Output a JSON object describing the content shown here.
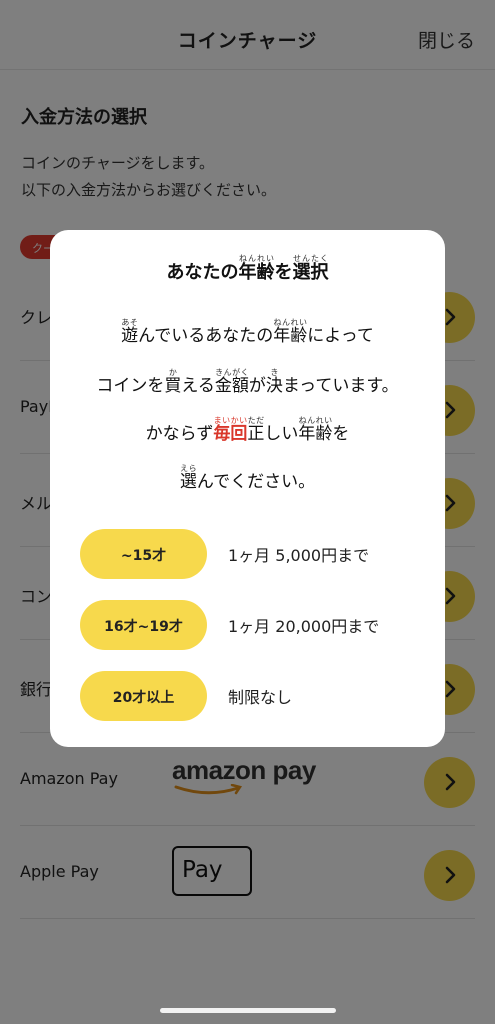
{
  "header": {
    "title": "コインチャージ",
    "close_label": "閉じる"
  },
  "section_title": "入金方法の選択",
  "description": {
    "line1": "コインのチャージをします。",
    "line2": "以下の入金方法からお選びください。"
  },
  "coupon_badge": "クーポン",
  "payment_methods": [
    {
      "label": "クレジットカード"
    },
    {
      "label": "PayPay"
    },
    {
      "label": "メルペイ"
    },
    {
      "label": "コンビニ"
    },
    {
      "label": "銀行振込"
    },
    {
      "label": "Amazon Pay",
      "logo_text": "amazon pay"
    },
    {
      "label": "Apple Pay",
      "logo_text": "Pay"
    }
  ],
  "modal": {
    "title_pre": "あなたの",
    "title_nenrei": "年齢",
    "title_nenrei_ruby": "ねんれい",
    "title_wo": "を",
    "title_sentaku": "選択",
    "title_sentaku_ruby": "せんたく",
    "body": {
      "l1_asobu": "遊",
      "l1_asobu_ruby": "あそ",
      "l1_mid": "んでいるあなたの",
      "l1_nenrei": "年齢",
      "l1_nenrei_ruby": "ねんれい",
      "l1_end": "によって",
      "l2_start": "コインを",
      "l2_kau": "買",
      "l2_kau_ruby": "か",
      "l2_mid": "える",
      "l2_kingaku": "金額",
      "l2_kingaku_ruby": "きんがく",
      "l2_ga": "が",
      "l2_kimaru": "決",
      "l2_kimaru_ruby": "き",
      "l2_end": "まっています。",
      "l3_start": "かならず",
      "l3_maikai": "毎回",
      "l3_maikai_ruby": "まいかい",
      "l3_tadashii": "正",
      "l3_tadashii_ruby": "ただ",
      "l3_mid": "しい",
      "l3_nenrei": "年齢",
      "l3_nenrei_ruby": "ねんれい",
      "l3_end": "を",
      "l4_erabu": "選",
      "l4_erabu_ruby": "えら",
      "l4_end": "んでください。"
    },
    "age_options": [
      {
        "label": "~15才",
        "limit": "1ヶ月 5,000円まで"
      },
      {
        "label": "16才~19才",
        "limit": "1ヶ月 20,000円まで"
      },
      {
        "label": "20才以上",
        "limit": "制限なし"
      }
    ]
  },
  "colors": {
    "accent_yellow": "#f7d94c",
    "highlight_red": "#d9372b",
    "badge_red": "#e23a2e"
  }
}
